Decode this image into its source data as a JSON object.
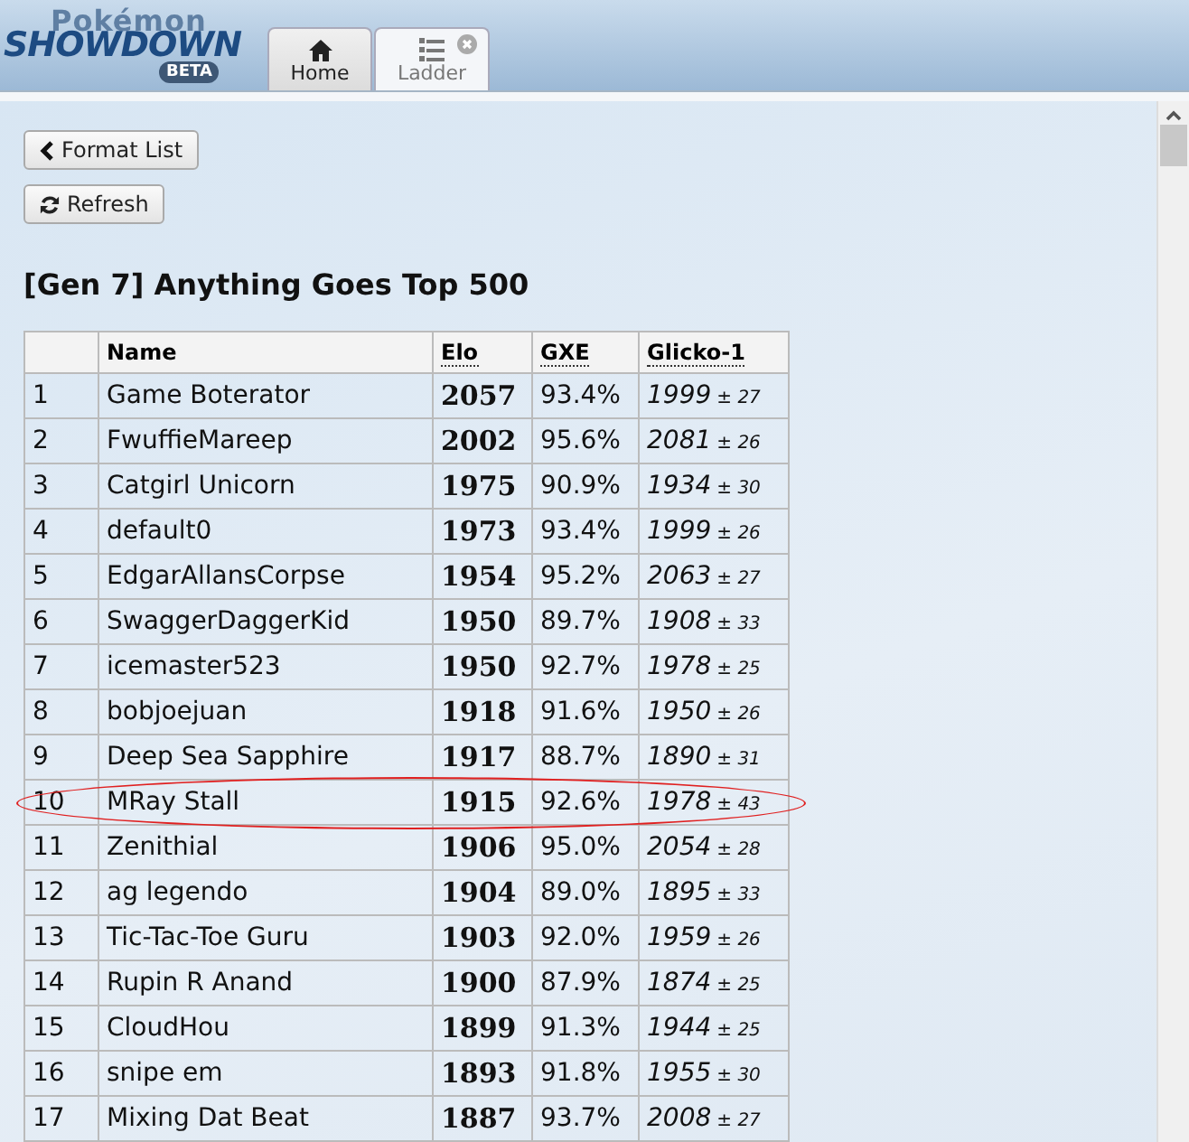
{
  "logo": {
    "top": "Pokémon",
    "main": "SHOWDOWN",
    "badge": "BETA"
  },
  "tabs": [
    {
      "label": "Home",
      "selected": false,
      "closable": false
    },
    {
      "label": "Ladder",
      "selected": true,
      "closable": true
    }
  ],
  "buttons": [
    {
      "label": "Format List"
    },
    {
      "label": "Refresh"
    }
  ],
  "title": "[Gen 7] Anything Goes Top 500",
  "table": {
    "columns": [
      "Name",
      "Elo",
      "GXE",
      "Glicko-1"
    ],
    "rows": [
      {
        "rank": "1",
        "name": "Game Boterator",
        "elo": "2057",
        "gxe": "93.4%",
        "glicko": "1999",
        "dev": "± 27",
        "circled": false
      },
      {
        "rank": "2",
        "name": "FwuffieMareep",
        "elo": "2002",
        "gxe": "95.6%",
        "glicko": "2081",
        "dev": "± 26",
        "circled": false
      },
      {
        "rank": "3",
        "name": "Catgirl Unicorn",
        "elo": "1975",
        "gxe": "90.9%",
        "glicko": "1934",
        "dev": "± 30",
        "circled": false
      },
      {
        "rank": "4",
        "name": "default0",
        "elo": "1973",
        "gxe": "93.4%",
        "glicko": "1999",
        "dev": "± 26",
        "circled": false
      },
      {
        "rank": "5",
        "name": "EdgarAllansCorpse",
        "elo": "1954",
        "gxe": "95.2%",
        "glicko": "2063",
        "dev": "± 27",
        "circled": false
      },
      {
        "rank": "6",
        "name": "SwaggerDaggerKid",
        "elo": "1950",
        "gxe": "89.7%",
        "glicko": "1908",
        "dev": "± 33",
        "circled": false
      },
      {
        "rank": "7",
        "name": "icemaster523",
        "elo": "1950",
        "gxe": "92.7%",
        "glicko": "1978",
        "dev": "± 25",
        "circled": false
      },
      {
        "rank": "8",
        "name": "bobjoejuan",
        "elo": "1918",
        "gxe": "91.6%",
        "glicko": "1950",
        "dev": "± 26",
        "circled": false
      },
      {
        "rank": "9",
        "name": "Deep Sea Sapphire",
        "elo": "1917",
        "gxe": "88.7%",
        "glicko": "1890",
        "dev": "± 31",
        "circled": false
      },
      {
        "rank": "10",
        "name": "MRay Stall",
        "elo": "1915",
        "gxe": "92.6%",
        "glicko": "1978",
        "dev": "± 43",
        "circled": true
      },
      {
        "rank": "11",
        "name": "Zenithial",
        "elo": "1906",
        "gxe": "95.0%",
        "glicko": "2054",
        "dev": "± 28",
        "circled": false
      },
      {
        "rank": "12",
        "name": "ag legendo",
        "elo": "1904",
        "gxe": "89.0%",
        "glicko": "1895",
        "dev": "± 33",
        "circled": false
      },
      {
        "rank": "13",
        "name": "Tic-Tac-Toe Guru",
        "elo": "1903",
        "gxe": "92.0%",
        "glicko": "1959",
        "dev": "± 26",
        "circled": false
      },
      {
        "rank": "14",
        "name": "Rupin R Anand",
        "elo": "1900",
        "gxe": "87.9%",
        "glicko": "1874",
        "dev": "± 25",
        "circled": false
      },
      {
        "rank": "15",
        "name": "CloudHou",
        "elo": "1899",
        "gxe": "91.3%",
        "glicko": "1944",
        "dev": "± 25",
        "circled": false
      },
      {
        "rank": "16",
        "name": "snipe em",
        "elo": "1893",
        "gxe": "91.8%",
        "glicko": "1955",
        "dev": "± 30",
        "circled": false
      },
      {
        "rank": "17",
        "name": "Mixing Dat Beat",
        "elo": "1887",
        "gxe": "93.7%",
        "glicko": "2008",
        "dev": "± 27",
        "circled": false
      }
    ]
  }
}
